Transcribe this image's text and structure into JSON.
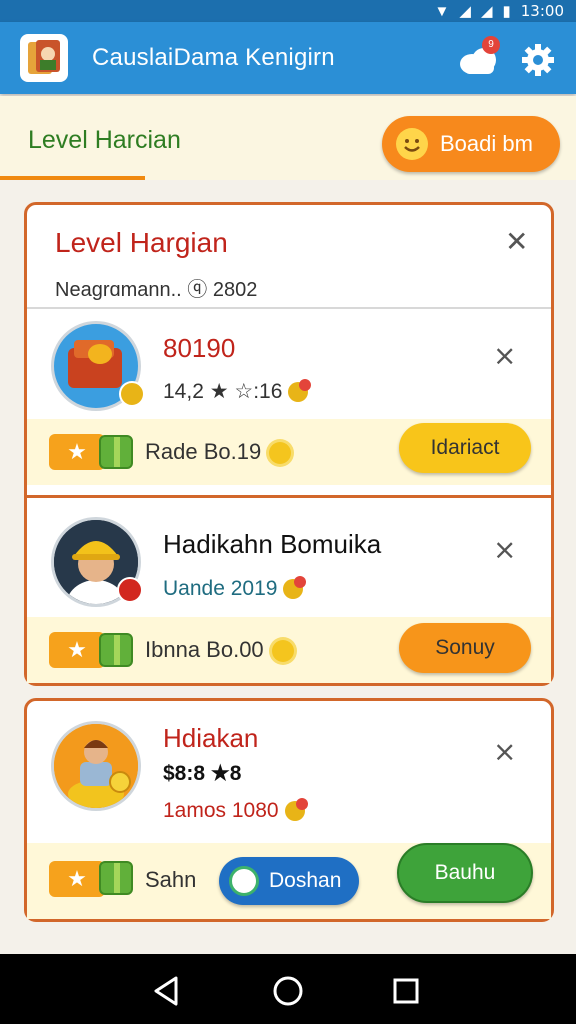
{
  "status_bar": {
    "time": "13:00"
  },
  "app_bar": {
    "title": "CauslaiDama Kenigirn",
    "notification_count": "9",
    "icons": [
      "app-logo-icon",
      "cloud-icon",
      "gear-icon"
    ]
  },
  "banner": {
    "level_title": "Level Harcian",
    "bonus_label": "Boadi bm"
  },
  "card": {
    "title": "Level Hargian",
    "subtitle": "Neagrɑmann.. ⓠ 2802"
  },
  "entries": [
    {
      "title": "80190",
      "sub": "14,2 ★ ☆:16",
      "reward_text": "Rade Bo.19",
      "button_label": "Idariact",
      "close": "⨯"
    },
    {
      "title": "Hadikahn Bomuika",
      "sub": "Uande 2019",
      "reward_text": "Ibnna Bo.00",
      "button_label": "Sonuy",
      "close": "⨯"
    },
    {
      "title": "Hdiakan",
      "price": "$8:8 ★8",
      "sub": "1amos 1080",
      "reward_text": "Sahn",
      "blue_button_label": "Doshan",
      "button_label": "Bauhu",
      "close": "⨯"
    }
  ],
  "colors": {
    "app_bar": "#2b8fd6",
    "accent_orange": "#f7891c",
    "title_red": "#c0241b",
    "level_green": "#2e7d22",
    "card_border": "#d2672a"
  }
}
